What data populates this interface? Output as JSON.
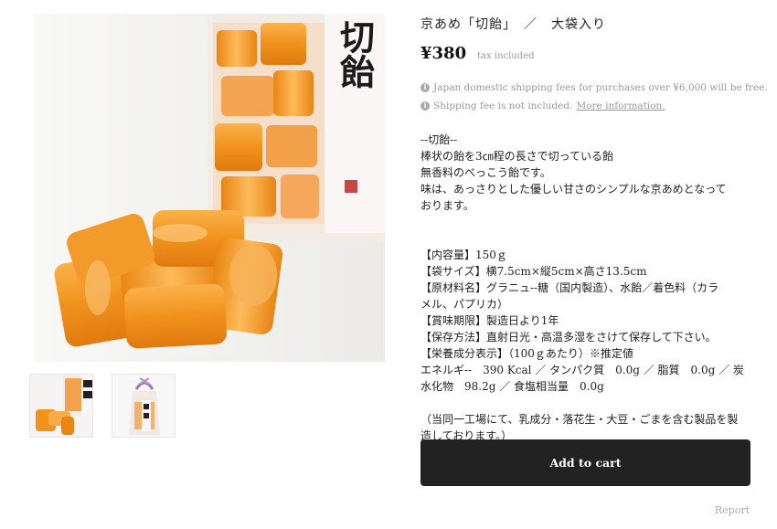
{
  "product": {
    "title": "京あめ「切飴」　／　大袋入り",
    "price": "¥380",
    "tax_note": "tax included",
    "package_label": "切飴",
    "notices": [
      {
        "text": "Japan domestic shipping fees for purchases over ¥6,000 will be free.",
        "link": ""
      },
      {
        "text": "Shipping fee is not included. ",
        "link": "More information."
      }
    ],
    "description": [
      "--切飴--",
      "棒状の飴を3㎝程の長さで切っている飴",
      "無香料のべっこう飴です。",
      "味は、あっさりとした優しい甘さのシンプルな京あめとなって",
      "おります。",
      "",
      "",
      "【内容量】150ｇ",
      "【袋サイズ】横7.5cm×縦5cm×高さ13.5cm",
      "【原材料名】グラニュ--糖（国内製造）、水飴／着色料（カラ",
      "メル、パプリカ）",
      "【賞味期限】製造日より1年",
      "【保存方法】直射日光・高温多湿をさけて保存して下さい。",
      "【栄養成分表示】（100ｇあたり）※推定値",
      "エネルギ--　390 Kcal ／ タンパク質　0.0g ／ 脂質　0.0g ／ 炭",
      "水化物　98.2g ／ 食塩相当量　0.0g",
      "",
      "（当同一工場にて、乳成分・落花生・大豆・ごまを含む製品を製",
      "造しております。）"
    ],
    "add_to_cart": "Add to cart",
    "report": "Report"
  },
  "colors": {
    "button": "#222222",
    "candy": "#f0951e",
    "muted_text": "#999999"
  },
  "icons": [
    "info-icon"
  ]
}
